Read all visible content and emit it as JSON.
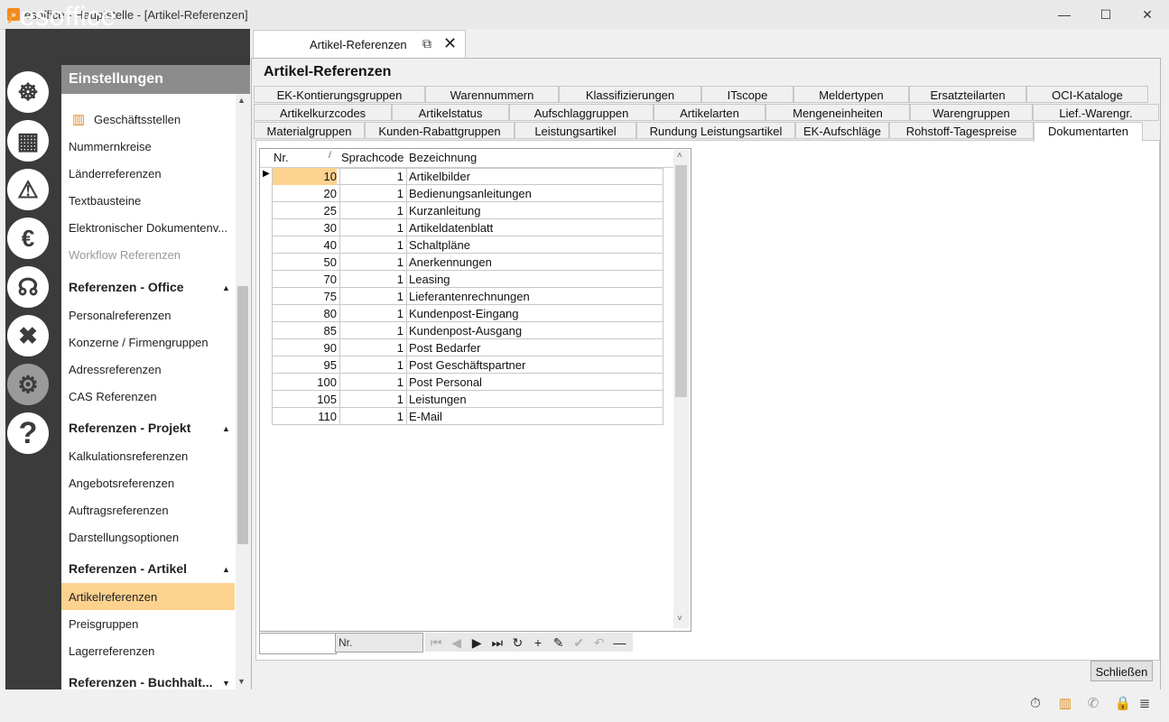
{
  "window": {
    "title": "esoffice - Hauptstelle - [Artikel-Referenzen]",
    "minimize": "—",
    "maximize": "☐",
    "close": "✕"
  },
  "logo": {
    "text": "esoffice"
  },
  "rail_icons": [
    "ship-wheel-icon",
    "calculator-icon",
    "alarm-light-icon",
    "money-icon",
    "headset-icon",
    "tools-icon",
    "gears-icon",
    "help-icon"
  ],
  "sidebar": {
    "header": "Einstellungen",
    "items_top": [
      {
        "label": "Geschäftsstellen"
      },
      {
        "label": "Nummernkreise"
      },
      {
        "label": "Länderreferenzen"
      },
      {
        "label": "Textbausteine"
      },
      {
        "label": "Elektronischer Dokumentenv..."
      },
      {
        "label": "Workflow Referenzen"
      }
    ],
    "sections": [
      {
        "title": "Referenzen - Office",
        "items": [
          "Personalreferenzen",
          "Konzerne / Firmengruppen",
          "Adressreferenzen",
          "CAS Referenzen"
        ]
      },
      {
        "title": "Referenzen - Projekt",
        "items": [
          "Kalkulationsreferenzen",
          "Angebotsreferenzen",
          "Auftragsreferenzen",
          "Darstellungsoptionen"
        ]
      },
      {
        "title": "Referenzen - Artikel",
        "items": [
          "Artikelreferenzen",
          "Preisgruppen",
          "Lagerreferenzen"
        ]
      },
      {
        "title": "Referenzen - Buchhalt...",
        "items": []
      }
    ],
    "selected": "Artikelreferenzen"
  },
  "doc_tab": {
    "label": "Artikel-Referenzen"
  },
  "content": {
    "title": "Artikel-Referenzen",
    "tab_rows": [
      [
        "EK-Kontierungsgruppen",
        "Warennummern",
        "Klassifizierungen",
        "ITscope",
        "Meldertypen",
        "Ersatzteilarten",
        "OCI-Kataloge"
      ],
      [
        "Artikelkurzcodes",
        "Artikelstatus",
        "Aufschlaggruppen",
        "Artikelarten",
        "Mengeneinheiten",
        "Warengruppen",
        "Lief.-Warengr."
      ],
      [
        "Materialgruppen",
        "Kunden-Rabattgruppen",
        "Leistungsartikel",
        "Rundung Leistungsartikel",
        "EK-Aufschläge",
        "Rohstoff-Tagespreise",
        "Dokumentarten"
      ]
    ],
    "active_tab": "Dokumentarten"
  },
  "grid": {
    "columns": [
      "Nr.",
      "Sprachcode",
      "Bezeichnung"
    ],
    "sort_indicator": "/",
    "rows": [
      {
        "nr": "10",
        "code": "1",
        "name": "Artikelbilder"
      },
      {
        "nr": "20",
        "code": "1",
        "name": "Bedienungsanleitungen"
      },
      {
        "nr": "25",
        "code": "1",
        "name": "Kurzanleitung"
      },
      {
        "nr": "30",
        "code": "1",
        "name": "Artikeldatenblatt"
      },
      {
        "nr": "40",
        "code": "1",
        "name": "Schaltpläne"
      },
      {
        "nr": "50",
        "code": "1",
        "name": "Anerkennungen"
      },
      {
        "nr": "70",
        "code": "1",
        "name": "Leasing"
      },
      {
        "nr": "75",
        "code": "1",
        "name": "Lieferantenrechnungen"
      },
      {
        "nr": "80",
        "code": "1",
        "name": "Kundenpost-Eingang"
      },
      {
        "nr": "85",
        "code": "1",
        "name": "Kundenpost-Ausgang"
      },
      {
        "nr": "90",
        "code": "1",
        "name": "Post Bedarfer"
      },
      {
        "nr": "95",
        "code": "1",
        "name": "Post Geschäftspartner"
      },
      {
        "nr": "100",
        "code": "1",
        "name": "Post Personal"
      },
      {
        "nr": "105",
        "code": "1",
        "name": "Leistungen"
      },
      {
        "nr": "110",
        "code": "1",
        "name": "E-Mail"
      }
    ]
  },
  "navigator": {
    "search_value": "",
    "field_value": "Nr.",
    "buttons": [
      {
        "name": "first-record-button",
        "glyph": "⏮",
        "enabled": false
      },
      {
        "name": "prev-record-button",
        "glyph": "◀",
        "enabled": false
      },
      {
        "name": "next-record-button",
        "glyph": "▶",
        "enabled": true
      },
      {
        "name": "last-record-button",
        "glyph": "⏭",
        "enabled": true
      },
      {
        "name": "refresh-button",
        "glyph": "↻",
        "enabled": true
      },
      {
        "name": "insert-button",
        "glyph": "+",
        "enabled": true
      },
      {
        "name": "edit-button",
        "glyph": "✎",
        "enabled": true
      },
      {
        "name": "post-button",
        "glyph": "✔",
        "enabled": false
      },
      {
        "name": "cancel-edit-button",
        "glyph": "↶",
        "enabled": false
      },
      {
        "name": "delete-button",
        "glyph": "—",
        "enabled": true
      }
    ]
  },
  "footer": {
    "close_label": "Schließen"
  },
  "status_icons": [
    "stopwatch-icon",
    "building-icon",
    "phone-icon",
    "lock-icon",
    "database-icon"
  ],
  "colors": {
    "rail": "#3b3b3b",
    "accent": "#f5a623",
    "selection": "#fdd28f"
  }
}
